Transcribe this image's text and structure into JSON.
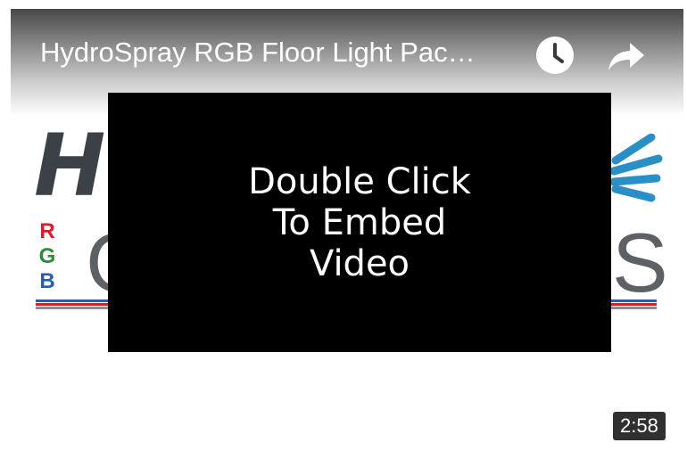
{
  "video": {
    "title": "HydroSpray RGB Floor Light Pac…",
    "duration": "2:58"
  },
  "thumbnail": {
    "logo_partial_left": "HY",
    "rgb_letters": [
      "R",
      "G",
      "B"
    ],
    "logo_partial_g": "G",
    "logo_partial_s": "S",
    "colors": {
      "logo_gray": "#3c4147",
      "red": "#d4202b",
      "green": "#2e8b3c",
      "blue": "#2a5fa8",
      "spray_blue": "#2b8fc7"
    }
  },
  "controls": {
    "watch_later_icon": "clock-icon",
    "share_icon": "share-arrow-icon"
  },
  "overlay": {
    "text": "Double Click\nTo Embed\nVideo"
  }
}
